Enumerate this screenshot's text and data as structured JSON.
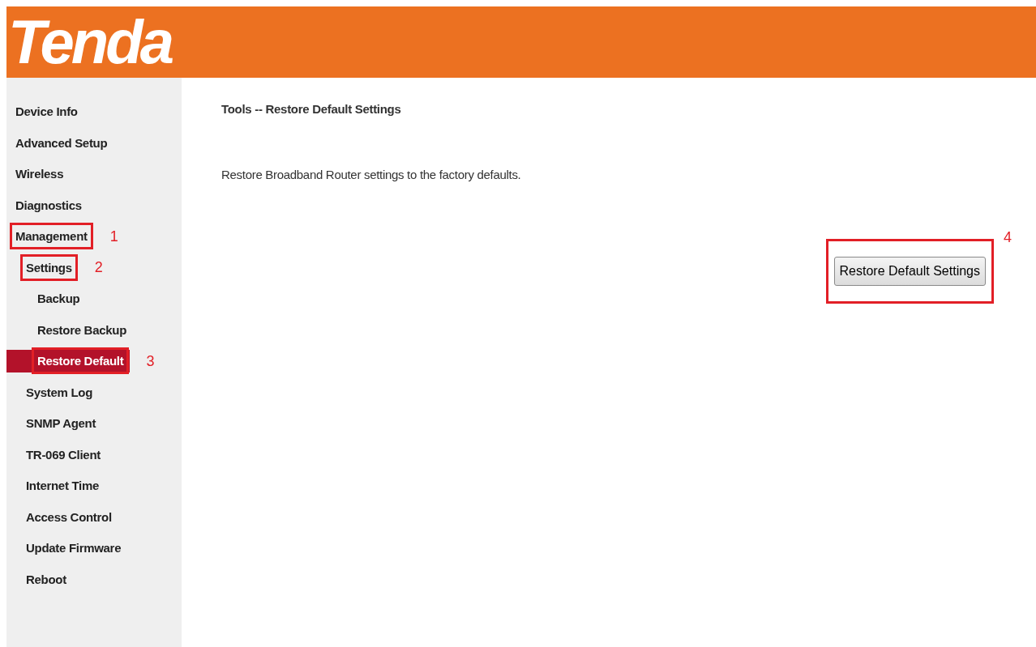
{
  "logo": "Tenda",
  "sidebar": {
    "items": [
      {
        "label": "Device Info",
        "selected": false
      },
      {
        "label": "Advanced Setup",
        "selected": false
      },
      {
        "label": "Wireless",
        "selected": false
      },
      {
        "label": "Diagnostics",
        "selected": false
      },
      {
        "label": "Management",
        "selected": false,
        "callout": "1",
        "children": [
          {
            "label": "Settings",
            "selected": false,
            "callout": "2",
            "children": [
              {
                "label": "Backup",
                "selected": false
              },
              {
                "label": "Restore Backup",
                "selected": false
              },
              {
                "label": "Restore Default",
                "selected": true,
                "callout": "3"
              }
            ]
          },
          {
            "label": "System Log",
            "selected": false
          },
          {
            "label": "SNMP Agent",
            "selected": false
          },
          {
            "label": "TR-069 Client",
            "selected": false
          },
          {
            "label": "Internet Time",
            "selected": false
          },
          {
            "label": "Access Control",
            "selected": false
          },
          {
            "label": "Update Firmware",
            "selected": false
          },
          {
            "label": "Reboot",
            "selected": false
          }
        ]
      }
    ]
  },
  "content": {
    "title": "Tools -- Restore Default Settings",
    "description": "Restore Broadband Router settings to the factory defaults.",
    "button": {
      "label": "Restore Default Settings",
      "callout": "4"
    }
  }
}
